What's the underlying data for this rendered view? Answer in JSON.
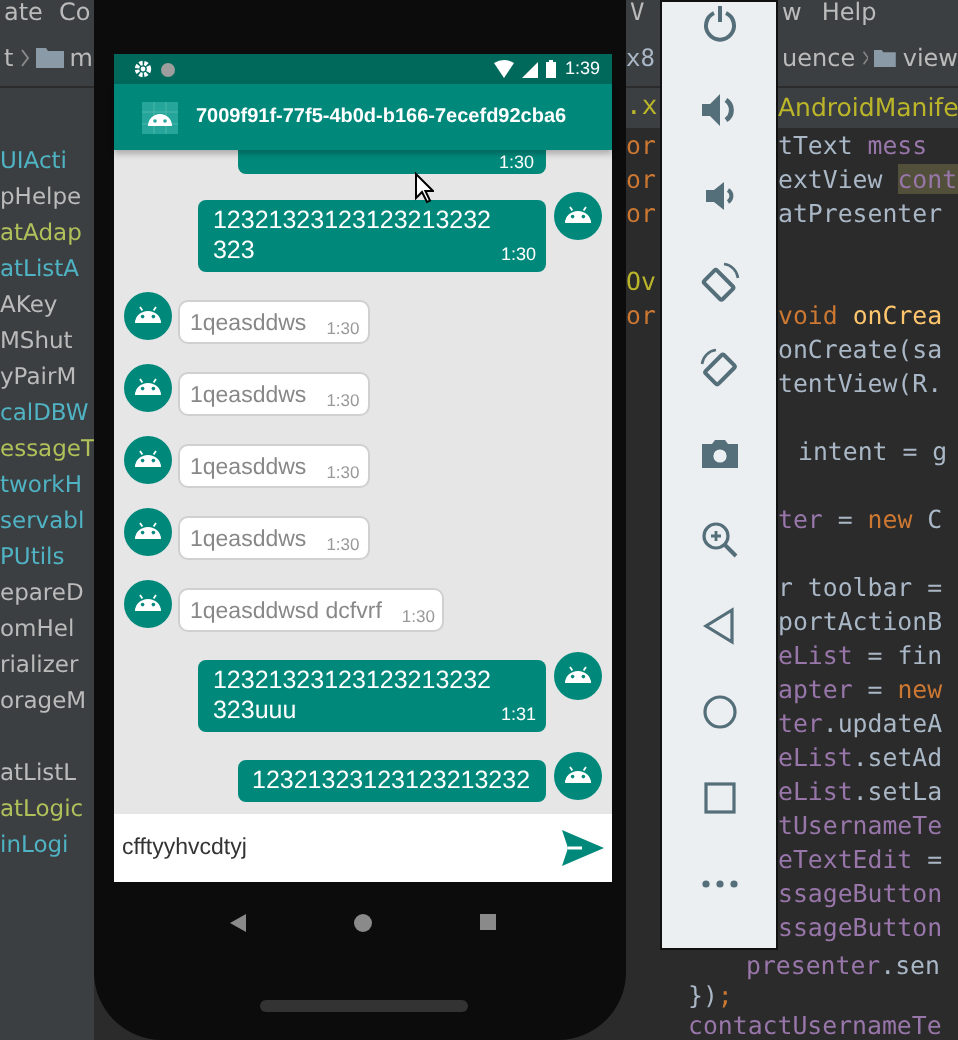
{
  "ide": {
    "menu_left": [
      "ate",
      "Co"
    ],
    "menu_middle": "V",
    "menu_right": [
      "w",
      "Help"
    ],
    "breadcrumb_left": [
      "t",
      "m"
    ],
    "breadcrumb_middle": "x8",
    "breadcrumb_right": [
      "uence",
      "view"
    ],
    "tab_middle": ".x",
    "editor_tab": "AndroidManife",
    "files": [
      {
        "name": "UIActi",
        "color": "#4fb3c4"
      },
      {
        "name": "pHelpe",
        "color": "#bbbbbb"
      },
      {
        "name": "atAdap",
        "color": "#b0c05a"
      },
      {
        "name": "atListA",
        "color": "#4fb3c4"
      },
      {
        "name": "AKey",
        "color": "#bbbbbb"
      },
      {
        "name": "MShut",
        "color": "#bbbbbb"
      },
      {
        "name": "yPairM",
        "color": "#bbbbbb"
      },
      {
        "name": "calDBW",
        "color": "#4fb3c4"
      },
      {
        "name": "essageT",
        "color": "#b0c05a"
      },
      {
        "name": "tworkH",
        "color": "#4fb3c4"
      },
      {
        "name": "servabl",
        "color": "#4fb3c4"
      },
      {
        "name": "PUtils",
        "color": "#4fb3c4"
      },
      {
        "name": "epareD",
        "color": "#bbbbbb"
      },
      {
        "name": "omHel",
        "color": "#bbbbbb"
      },
      {
        "name": "rializer",
        "color": "#bbbbbb"
      },
      {
        "name": "orageM",
        "color": "#bbbbbb"
      },
      {
        "name": "atListL",
        "color": "#bbbbbb"
      },
      {
        "name": "atLogic",
        "color": "#b0c05a"
      },
      {
        "name": "inLogi",
        "color": "#4fb3c4"
      }
    ],
    "gutter_fragments": [
      {
        "kind": "keyword",
        "text": "or"
      },
      {
        "kind": "keyword",
        "text": "or"
      },
      {
        "kind": "keyword",
        "text": "or"
      },
      {
        "kind": "blank"
      },
      {
        "kind": "annotation",
        "text": "Ov"
      },
      {
        "kind": "keyword",
        "text": "or"
      }
    ],
    "code_lines": [
      {
        "tokens": [
          {
            "kind": "plain",
            "text": "tText "
          },
          {
            "kind": "field",
            "text": "mess"
          }
        ]
      },
      {
        "tokens": [
          {
            "kind": "plain",
            "text": "extView "
          },
          {
            "kind": "highlight",
            "text": "cont"
          }
        ]
      },
      {
        "tokens": [
          {
            "kind": "plain",
            "text": "atPresenter"
          }
        ]
      },
      {
        "kind": "blank"
      },
      {
        "kind": "blank"
      },
      {
        "tokens": [
          {
            "kind": "keyword",
            "text": "void "
          },
          {
            "kind": "method",
            "text": "onCrea"
          }
        ]
      },
      {
        "tokens": [
          {
            "kind": "plain",
            "text": "onCreate(sa"
          }
        ]
      },
      {
        "tokens": [
          {
            "kind": "plain",
            "text": "tentView(R."
          }
        ]
      },
      {
        "kind": "blank"
      },
      {
        "kind": "indented",
        "tokens": [
          {
            "kind": "plain",
            "text": "intent = g"
          }
        ]
      },
      {
        "kind": "blank"
      },
      {
        "tokens": [
          {
            "kind": "field",
            "text": "ter"
          },
          {
            "kind": "plain",
            "text": " = "
          },
          {
            "kind": "keyword",
            "text": "new "
          },
          {
            "kind": "plain",
            "text": "C"
          }
        ]
      },
      {
        "kind": "blank"
      },
      {
        "tokens": [
          {
            "kind": "plain",
            "text": "r toolbar ="
          }
        ]
      },
      {
        "tokens": [
          {
            "kind": "plain",
            "text": "portActionB"
          }
        ]
      },
      {
        "tokens": [
          {
            "kind": "field",
            "text": "eList"
          },
          {
            "kind": "plain",
            "text": " = fin"
          }
        ]
      },
      {
        "tokens": [
          {
            "kind": "field",
            "text": "apter"
          },
          {
            "kind": "plain",
            "text": " = "
          },
          {
            "kind": "keyword",
            "text": "new"
          }
        ]
      },
      {
        "tokens": [
          {
            "kind": "field",
            "text": "ter"
          },
          {
            "kind": "plain",
            "text": ".updateA"
          }
        ]
      },
      {
        "tokens": [
          {
            "kind": "field",
            "text": "eList"
          },
          {
            "kind": "plain",
            "text": ".setAd"
          }
        ]
      },
      {
        "tokens": [
          {
            "kind": "field",
            "text": "eList"
          },
          {
            "kind": "plain",
            "text": ".setLa"
          }
        ]
      },
      {
        "tokens": [
          {
            "kind": "field",
            "text": "tUsernameTe"
          }
        ]
      },
      {
        "tokens": [
          {
            "kind": "field",
            "text": "eTextEdit"
          },
          {
            "kind": "plain",
            "text": " ="
          }
        ]
      },
      {
        "tokens": [
          {
            "kind": "field",
            "text": "ssageButton"
          }
        ]
      },
      {
        "tokens": [
          {
            "kind": "field",
            "text": "ssageButton"
          }
        ]
      }
    ],
    "code_tail": {
      "nested_line": {
        "tokens": [
          {
            "kind": "field",
            "text": "presenter"
          },
          {
            "kind": "plain",
            "text": ".sen"
          }
        ]
      },
      "lines": [
        {
          "tokens": [
            {
              "kind": "plain",
              "text": "})"
            },
            {
              "kind": "keyword",
              "text": ";"
            }
          ]
        },
        {
          "tokens": [
            {
              "kind": "field",
              "text": "contactUsernameTe"
            }
          ]
        }
      ]
    }
  },
  "phone": {
    "status_bar": {
      "time": "1:39"
    },
    "app_bar": {
      "title": "7009f91f-77f5-4b0d-b166-7ecefd92cba6"
    },
    "messages": [
      {
        "kind": "outgoing",
        "time": "1:30"
      },
      {
        "kind": "outgoing",
        "text": "12321323123123213232323",
        "time": "1:30"
      },
      {
        "kind": "incoming",
        "text": "1qeasddws",
        "time": "1:30"
      },
      {
        "kind": "incoming",
        "text": "1qeasddws",
        "time": "1:30"
      },
      {
        "kind": "incoming",
        "text": "1qeasddws",
        "time": "1:30"
      },
      {
        "kind": "incoming",
        "text": "1qeasddws",
        "time": "1:30"
      },
      {
        "kind": "incoming",
        "text": "1qeasddwsd dcfvrf",
        "time": "1:30"
      },
      {
        "kind": "outgoing",
        "text": "12321323123123213232323uuu",
        "time": "1:31"
      },
      {
        "kind": "outgoing",
        "text": "12321323123123213232"
      }
    ],
    "input": {
      "value": "cfftyyhvcdtyj"
    }
  }
}
